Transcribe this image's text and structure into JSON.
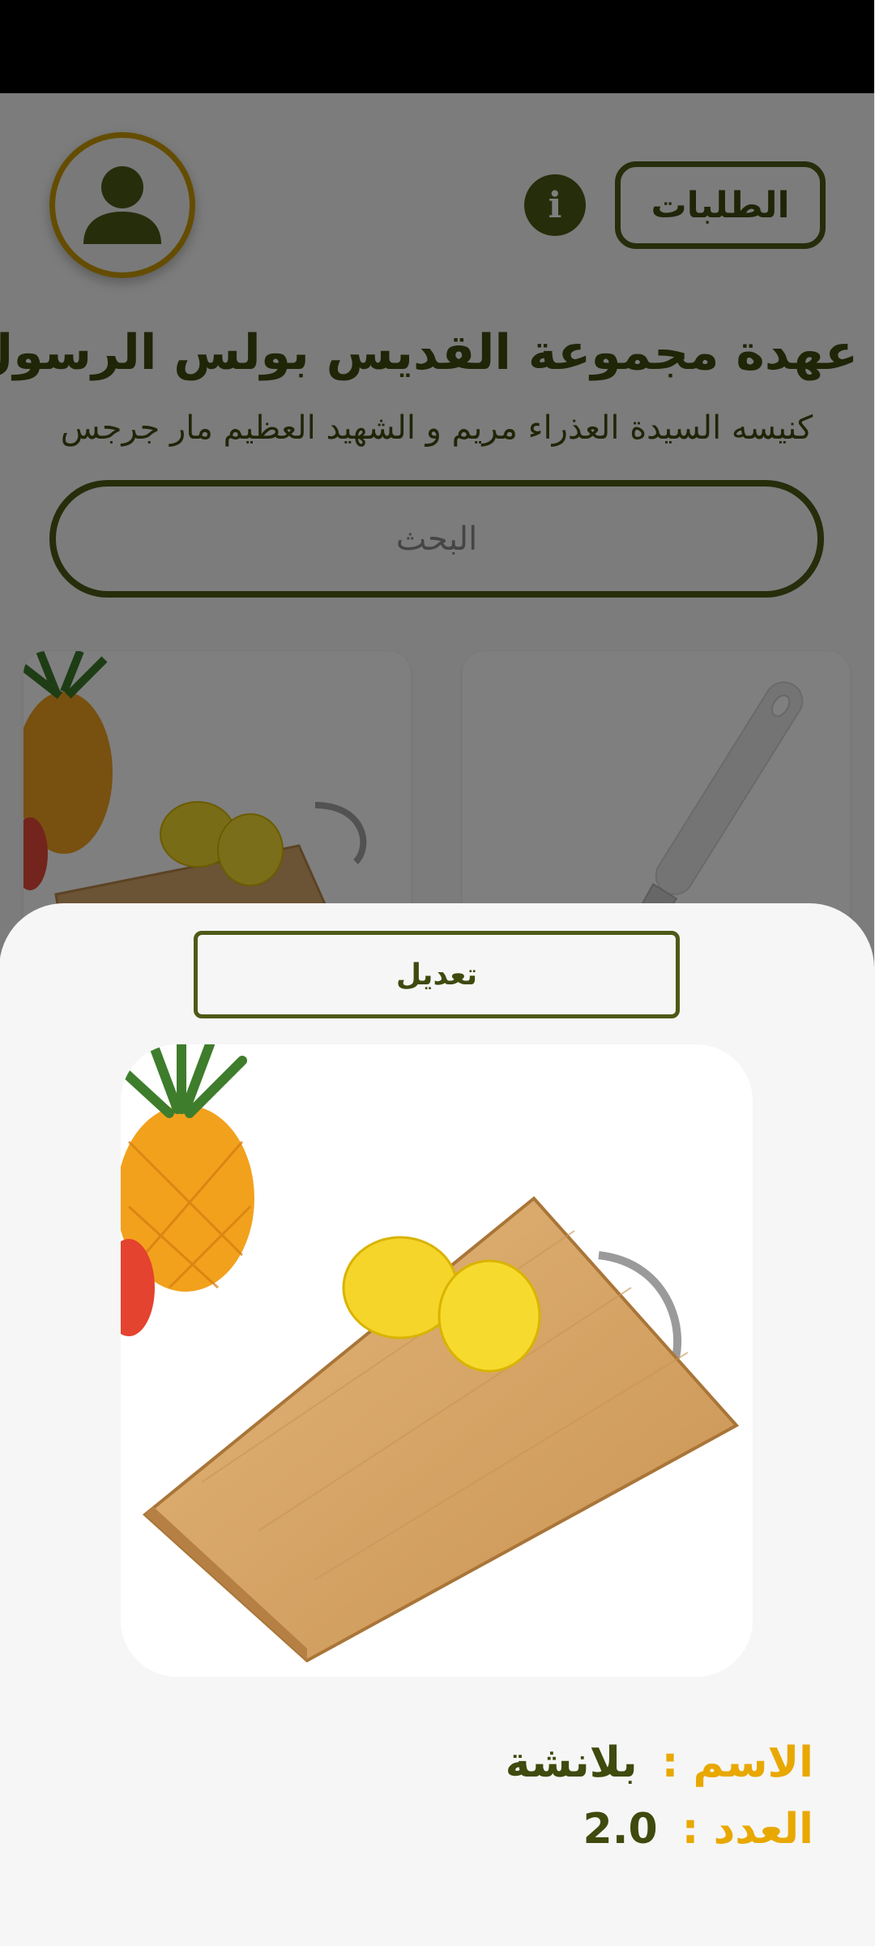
{
  "header": {
    "requests_label": "الطلبات",
    "info_icon": "info-icon",
    "avatar_icon": "person-icon"
  },
  "page": {
    "title": "عهدة مجموعة القديس بولس الرسول",
    "subtitle": "كنيسه السيدة العذراء مريم و الشهيد العظيم مار جرجس"
  },
  "search": {
    "placeholder": "البحث",
    "value": ""
  },
  "products": [
    {
      "image": "knife-photo"
    },
    {
      "image": "cutting-board-photo"
    }
  ],
  "sheet": {
    "edit_label": "تعديل",
    "image": "cutting-board-photo",
    "name_label": "الاسم :",
    "name_value": "بلانشة",
    "count_label": "العدد :",
    "count_value": "2.0"
  },
  "colors": {
    "primary": "#4d5a16",
    "text_dark": "#3e4a0e",
    "accent": "#e8a800",
    "avatar_border": "#c99a00"
  }
}
